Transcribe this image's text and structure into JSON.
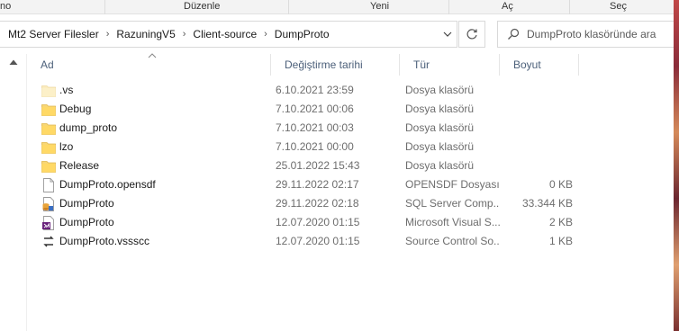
{
  "ribbon": {
    "groups": [
      "no",
      "Düzenle",
      "Yeni",
      "Aç",
      "Seç"
    ]
  },
  "address": {
    "crumbs": [
      "Mt2 Server Filesler",
      "RazuningV5",
      "Client-source",
      "DumpProto"
    ]
  },
  "search": {
    "placeholder": "DumpProto klasöründe ara"
  },
  "columns": {
    "name": "Ad",
    "date": "Değiştirme tarihi",
    "type": "Tür",
    "size": "Boyut"
  },
  "files": [
    {
      "icon": "folder-faded-icon",
      "name": ".vs",
      "date": "6.10.2021 23:59",
      "type": "Dosya klasörü",
      "size": ""
    },
    {
      "icon": "folder-icon",
      "name": "Debug",
      "date": "7.10.2021 00:06",
      "type": "Dosya klasörü",
      "size": ""
    },
    {
      "icon": "folder-icon",
      "name": "dump_proto",
      "date": "7.10.2021 00:03",
      "type": "Dosya klasörü",
      "size": ""
    },
    {
      "icon": "folder-icon",
      "name": "lzo",
      "date": "7.10.2021 00:00",
      "type": "Dosya klasörü",
      "size": ""
    },
    {
      "icon": "folder-icon",
      "name": "Release",
      "date": "25.01.2022 15:43",
      "type": "Dosya klasörü",
      "size": ""
    },
    {
      "icon": "blank-file-icon",
      "name": "DumpProto.opensdf",
      "date": "29.11.2022 02:17",
      "type": "OPENSDF Dosyası",
      "size": "0 KB"
    },
    {
      "icon": "sql-database-file-icon",
      "name": "DumpProto",
      "date": "29.11.2022 02:18",
      "type": "SQL Server Comp...",
      "size": "33.344 KB"
    },
    {
      "icon": "visual-studio-solution-icon",
      "name": "DumpProto",
      "date": "12.07.2020 01:15",
      "type": "Microsoft Visual S...",
      "size": "2 KB"
    },
    {
      "icon": "source-control-file-icon",
      "name": "DumpProto.vssscc",
      "date": "12.07.2020 01:15",
      "type": "Source Control So...",
      "size": "1 KB"
    }
  ],
  "colors": {
    "folder": "#f8d775",
    "header_text": "#4c607a",
    "meta_text": "#6d6d6d",
    "vs_purple": "#68217a"
  }
}
